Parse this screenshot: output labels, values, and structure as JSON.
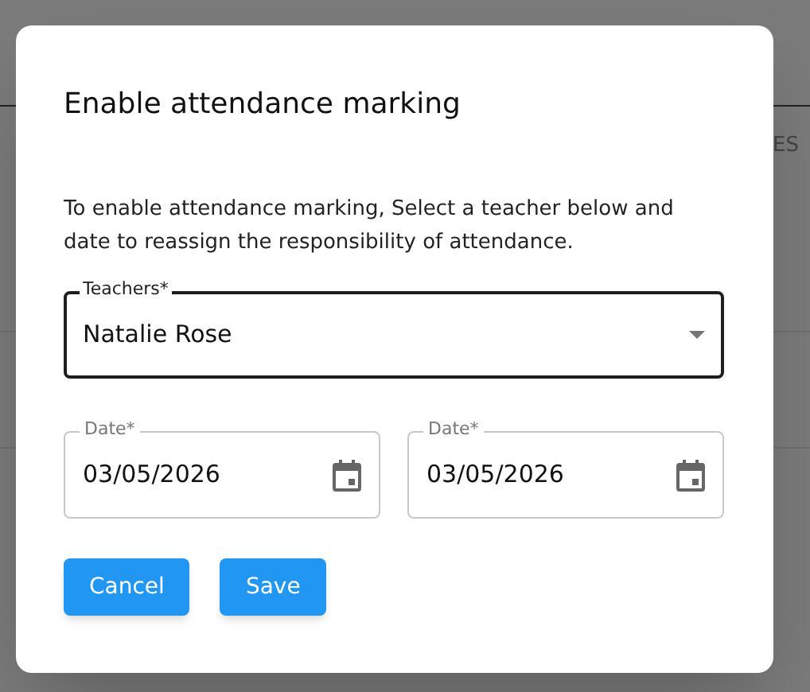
{
  "background": {
    "header_cells": [
      "ES"
    ]
  },
  "dialog": {
    "title": "Enable attendance marking",
    "description": "To enable attendance marking, Select a teacher below and date to reassign the responsibility of attendance.",
    "teacher_field": {
      "label": "Teachers*",
      "value": "Natalie Rose",
      "focused": true
    },
    "date_fields": [
      {
        "label": "Date*",
        "value": "03/05/2026"
      },
      {
        "label": "Date*",
        "value": "03/05/2026"
      }
    ],
    "buttons": [
      "Cancel",
      "Save"
    ]
  }
}
